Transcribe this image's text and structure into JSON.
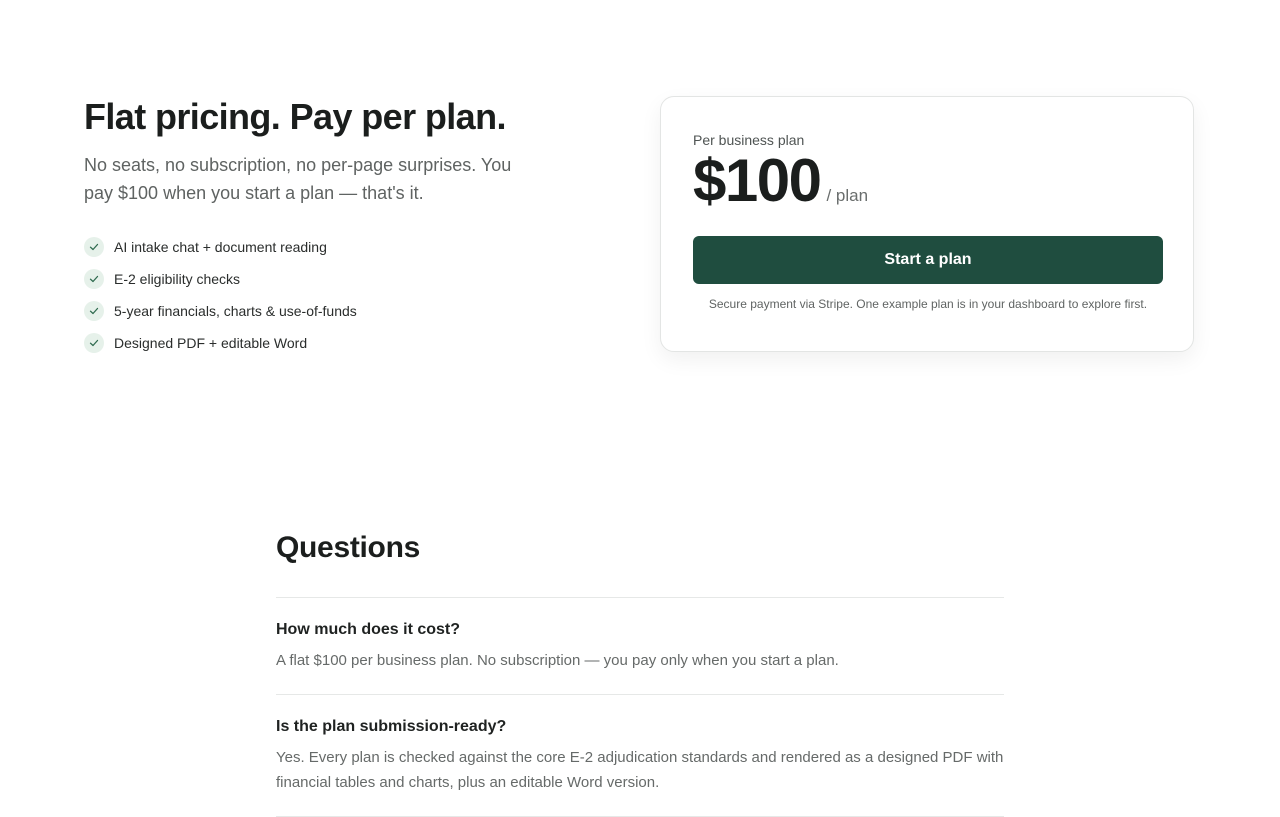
{
  "pricing": {
    "title": "Flat pricing. Pay per plan.",
    "subtitle": "No seats, no subscription, no per-page surprises. You pay $100 when you start a plan — that's it.",
    "features": [
      "AI intake chat + document reading",
      "E-2 eligibility checks",
      "5-year financials, charts & use-of-funds",
      "Designed PDF + editable Word"
    ],
    "feature_icon": "check-icon"
  },
  "card": {
    "label": "Per business plan",
    "price": "$100",
    "unit": "/ plan",
    "button_label": "Start a plan",
    "footnote": "Secure payment via Stripe. One example plan is in your dashboard to explore first."
  },
  "faq": {
    "title": "Questions",
    "items": [
      {
        "question": "How much does it cost?",
        "answer": "A flat $100 per business plan. No subscription — you pay only when you start a plan."
      },
      {
        "question": "Is the plan submission-ready?",
        "answer": "Yes. Every plan is checked against the core E-2 adjudication standards and rendered as a designed PDF with financial tables and charts, plus an editable Word version."
      }
    ]
  },
  "colors": {
    "accent": "#1f4d3f",
    "check_bg": "#e6f1ea",
    "check_stroke": "#2f6b4f"
  }
}
